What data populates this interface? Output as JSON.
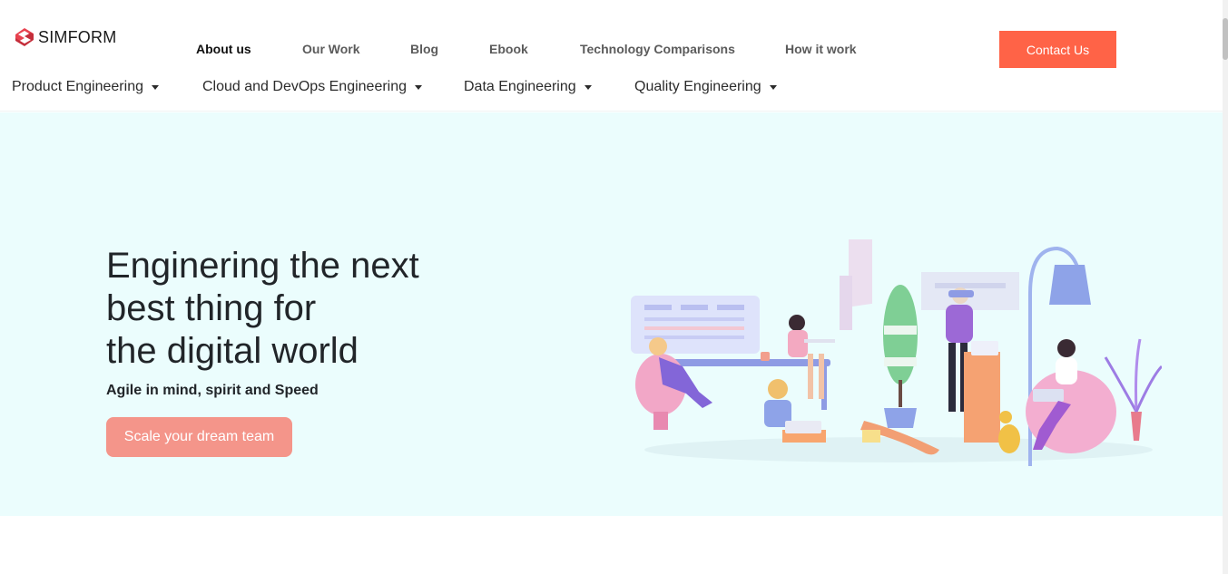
{
  "header": {
    "brand": "SIMFORM",
    "top_nav": [
      {
        "label": "About us",
        "active": true
      },
      {
        "label": "Our Work",
        "active": false
      },
      {
        "label": "Blog",
        "active": false
      },
      {
        "label": "Ebook",
        "active": false
      },
      {
        "label": "Technology Comparisons",
        "active": false
      },
      {
        "label": "How it work",
        "active": false
      }
    ],
    "contact_label": "Contact Us",
    "sub_nav": [
      {
        "label": "Product Engineering"
      },
      {
        "label": "Cloud and DevOps Engineering"
      },
      {
        "label": "Data Engineering"
      },
      {
        "label": "Quality Engineering"
      }
    ]
  },
  "hero": {
    "title_lines": [
      "Enginering the next",
      "best thing for",
      "the digital world"
    ],
    "subtitle": "Agile in mind, spirit and Speed",
    "cta_label": "Scale your dream team",
    "illustration_icon": "office-team-illustration"
  },
  "colors": {
    "brand_accent": "#ff6347",
    "cta": "#f4958a",
    "hero_bg": "#ebfdfd",
    "logo_red": "#e8424f"
  }
}
